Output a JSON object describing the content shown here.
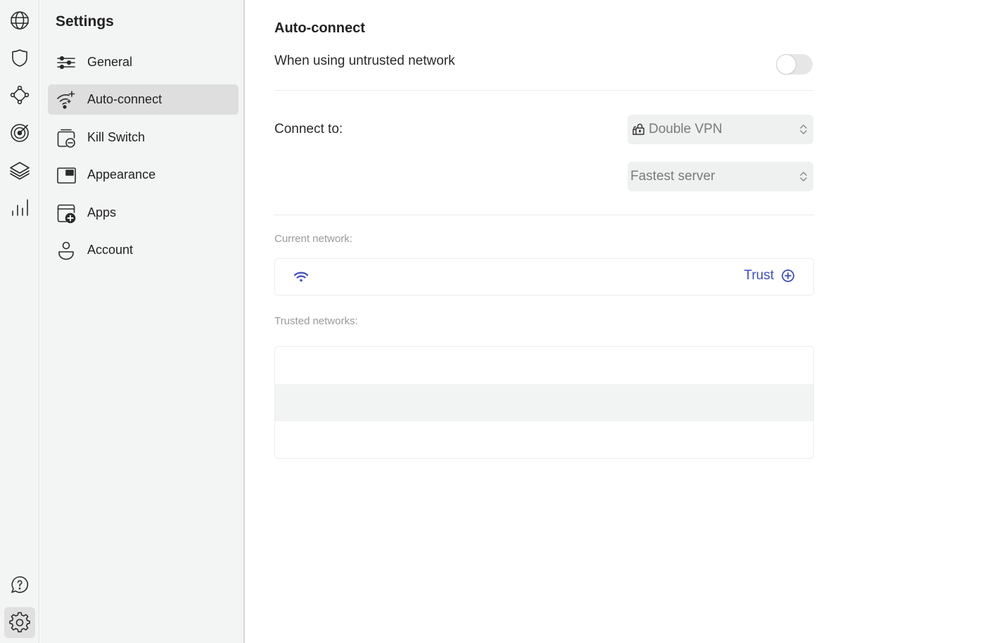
{
  "rail": {
    "top_items": [
      {
        "id": "globe",
        "icon": "globe-icon"
      },
      {
        "id": "shield",
        "icon": "shield-icon"
      },
      {
        "id": "meshnet",
        "icon": "meshnet-icon"
      },
      {
        "id": "threat-protection",
        "icon": "target-icon"
      },
      {
        "id": "layers",
        "icon": "layers-icon"
      },
      {
        "id": "stats",
        "icon": "bar-chart-icon"
      }
    ],
    "bottom_items": [
      {
        "id": "help",
        "icon": "help-bubble-icon"
      },
      {
        "id": "settings",
        "icon": "gear-icon",
        "active": true
      }
    ]
  },
  "sidebar": {
    "title": "Settings",
    "items": [
      {
        "label": "General",
        "icon": "sliders-icon"
      },
      {
        "label": "Auto-connect",
        "icon": "wifi-sparkle-icon",
        "active": true
      },
      {
        "label": "Kill Switch",
        "icon": "kill-switch-icon"
      },
      {
        "label": "Appearance",
        "icon": "appearance-icon"
      },
      {
        "label": "Apps",
        "icon": "apps-add-icon"
      },
      {
        "label": "Account",
        "icon": "user-icon"
      }
    ]
  },
  "main": {
    "title": "Auto-connect",
    "untrusted": {
      "label": "When using untrusted network",
      "enabled": false
    },
    "connect_to": {
      "label": "Connect to:",
      "server_type": {
        "value": "Double VPN",
        "icon": "double-lock-icon"
      },
      "server": {
        "value": "Fastest server"
      }
    },
    "current_network": {
      "label": "Current network:",
      "icon": "wifi-icon",
      "trust_label": "Trust",
      "trust_icon": "plus-circle-icon"
    },
    "trusted_networks": {
      "label": "Trusted networks:",
      "rows": [
        "",
        "",
        ""
      ]
    }
  },
  "colors": {
    "accent": "#3f4fbf",
    "sidebar_bg": "#f3f4f4",
    "active_item_bg": "#dedede",
    "select_bg": "#eff0f0"
  }
}
